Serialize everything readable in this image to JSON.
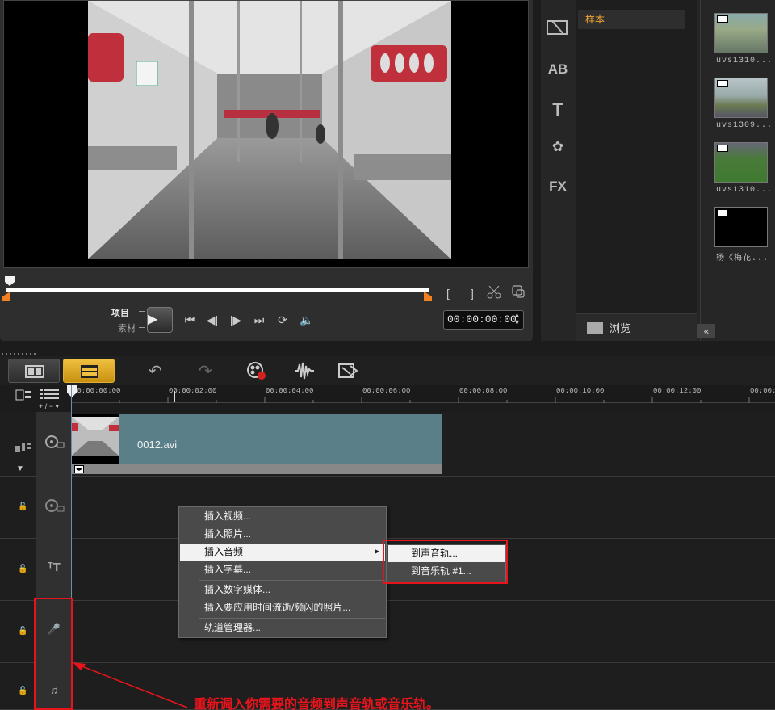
{
  "preview": {
    "mode_project": "项目",
    "mode_clip": "素材",
    "timecode": "00:00:00:00",
    "trim_in": "[",
    "trim_out": "]",
    "icons": [
      "play-icon",
      "prev-start-icon",
      "prev-frame-icon",
      "next-frame-icon",
      "next-end-icon",
      "repeat-icon",
      "volume-icon",
      "cut-icon",
      "enlarge-icon"
    ]
  },
  "library": {
    "folder": "样本",
    "browse_label": "浏览",
    "thumbnails": [
      {
        "caption": "uvs1310..."
      },
      {
        "caption": "uvs1309..."
      },
      {
        "caption": "uvs1310..."
      },
      {
        "caption": "杨《梅花..."
      }
    ],
    "tab_icons": [
      "media-icon",
      "transition-icon",
      "title-icon",
      "graphic-icon",
      "filter-icon"
    ],
    "tab_labels": [
      "AB",
      "T",
      "FX"
    ]
  },
  "timeline": {
    "ruler_labels": [
      "00:00:00:00",
      "00:00:02:00",
      "00:00:04:00",
      "00:00:06:00",
      "00:00:08:00",
      "00:00:10:00",
      "00:00:12:00",
      "00:00:1"
    ],
    "zoom_label": "+ / −",
    "clip_name": "0012.avi",
    "toolbar_icons": [
      "undo-icon",
      "redo-icon",
      "record-icon",
      "audio-mix-icon",
      "auto-music-icon"
    ]
  },
  "context_menu": {
    "items": [
      "插入视频...",
      "插入照片...",
      "插入音频",
      "插入字幕...",
      "插入数字媒体...",
      "插入要应用时间流逝/频闪的照片...",
      "轨道管理器..."
    ],
    "submenu": [
      "到声音轨...",
      "到音乐轨 #1..."
    ]
  },
  "annotation": {
    "text": "重新调入你需要的音频到声音轨或音乐轨。",
    "color": "#e8141c"
  }
}
